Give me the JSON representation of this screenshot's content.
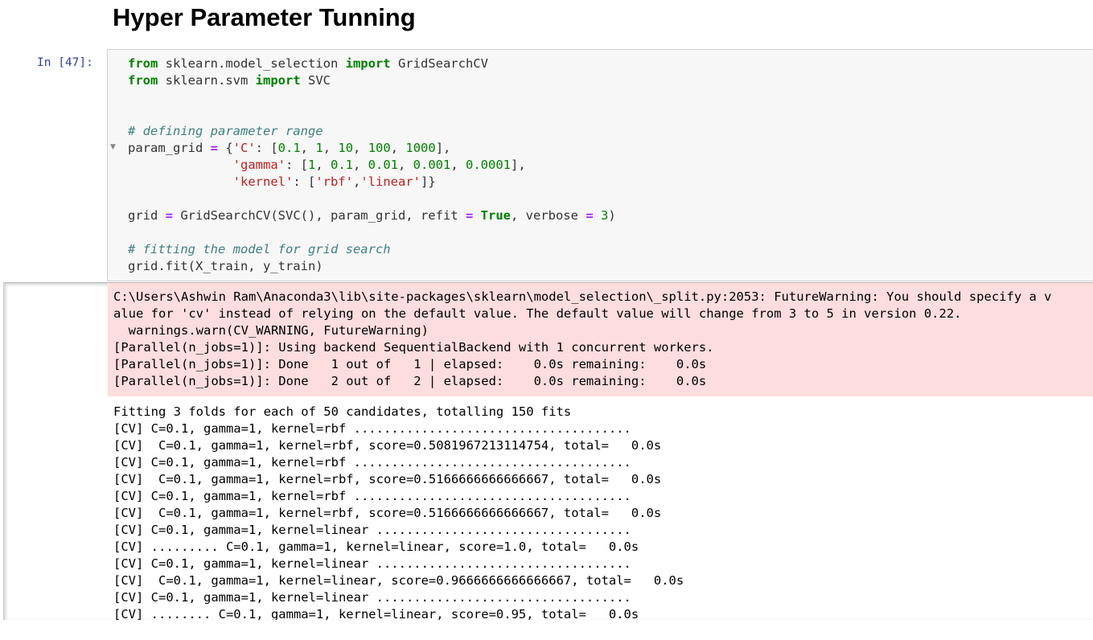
{
  "heading": "Hyper Parameter Tunning",
  "prompt": "In [47]:",
  "code": {
    "line1": {
      "kw1": "from",
      "mod": " sklearn.model_selection ",
      "kw2": "import",
      "name": " GridSearchCV"
    },
    "line2": {
      "kw1": "from",
      "mod": " sklearn.svm ",
      "kw2": "import",
      "name": " SVC"
    },
    "comment1": "# defining parameter range",
    "line6": {
      "var": "param_grid ",
      "eq": "=",
      "p1": " {",
      "key": "'C'",
      "p2": ": [",
      "n1": "0.1",
      "c1": ", ",
      "n2": "1",
      "c2": ", ",
      "n3": "10",
      "c3": ", ",
      "n4": "100",
      "c4": ", ",
      "n5": "1000",
      "p3": "],"
    },
    "line7": {
      "indent": "              ",
      "key": "'gamma'",
      "p1": ": [",
      "n1": "1",
      "c1": ", ",
      "n2": "0.1",
      "c2": ", ",
      "n3": "0.01",
      "c3": ", ",
      "n4": "0.001",
      "c4": ", ",
      "n5": "0.0001",
      "p2": "],"
    },
    "line8": {
      "indent": "              ",
      "key": "'kernel'",
      "p1": ": [",
      "s1": "'rbf'",
      "c1": ",",
      "s2": "'linear'",
      "p2": "]}"
    },
    "line10": {
      "var": "grid ",
      "eq": "=",
      "call": " GridSearchCV(SVC(), param_grid, refit ",
      "eq2": "=",
      "sp": " ",
      "val": "True",
      "mid": ", verbose ",
      "eq3": "=",
      "sp2": " ",
      "num": "3",
      "end": ")"
    },
    "comment2": "# fitting the model for grid search",
    "line13": "grid.fit(X_train, y_train)"
  },
  "stderr_lines": [
    "C:\\Users\\Ashwin Ram\\Anaconda3\\lib\\site-packages\\sklearn\\model_selection\\_split.py:2053: FutureWarning: You should specify a v",
    "alue for 'cv' instead of relying on the default value. The default value will change from 3 to 5 in version 0.22.",
    "  warnings.warn(CV_WARNING, FutureWarning)",
    "[Parallel(n_jobs=1)]: Using backend SequentialBackend with 1 concurrent workers.",
    "[Parallel(n_jobs=1)]: Done   1 out of   1 | elapsed:    0.0s remaining:    0.0s",
    "[Parallel(n_jobs=1)]: Done   2 out of   2 | elapsed:    0.0s remaining:    0.0s"
  ],
  "stdout_lines": [
    "Fitting 3 folds for each of 50 candidates, totalling 150 fits",
    "[CV] C=0.1, gamma=1, kernel=rbf .....................................",
    "[CV]  C=0.1, gamma=1, kernel=rbf, score=0.5081967213114754, total=   0.0s",
    "[CV] C=0.1, gamma=1, kernel=rbf .....................................",
    "[CV]  C=0.1, gamma=1, kernel=rbf, score=0.5166666666666667, total=   0.0s",
    "[CV] C=0.1, gamma=1, kernel=rbf .....................................",
    "[CV]  C=0.1, gamma=1, kernel=rbf, score=0.5166666666666667, total=   0.0s",
    "[CV] C=0.1, gamma=1, kernel=linear ..................................",
    "[CV] ......... C=0.1, gamma=1, kernel=linear, score=1.0, total=   0.0s",
    "[CV] C=0.1, gamma=1, kernel=linear ..................................",
    "[CV]  C=0.1, gamma=1, kernel=linear, score=0.9666666666666667, total=   0.0s",
    "[CV] C=0.1, gamma=1, kernel=linear ..................................",
    "[CV] ........ C=0.1, gamma=1, kernel=linear, score=0.95, total=   0.0s"
  ]
}
